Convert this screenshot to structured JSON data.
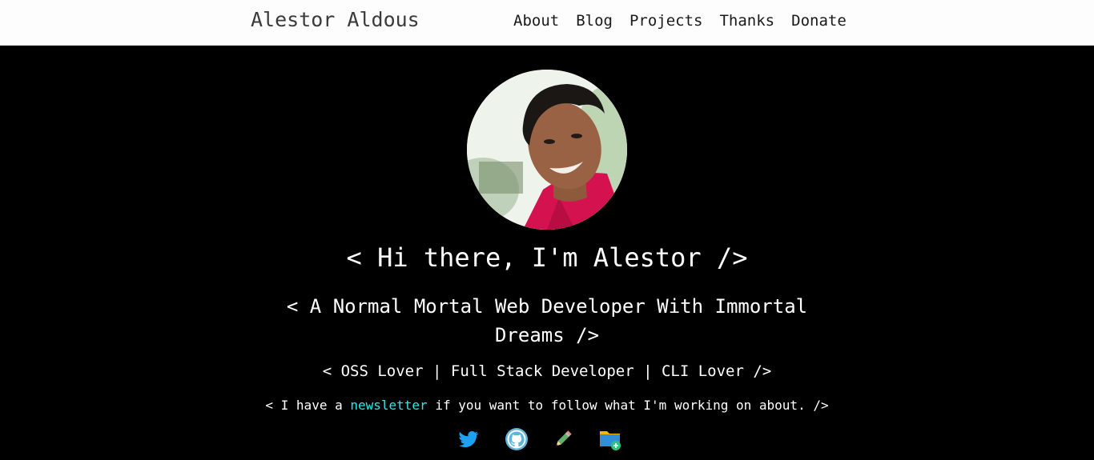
{
  "header": {
    "brand": "Alestor Aldous",
    "nav": [
      "About",
      "Blog",
      "Projects",
      "Thanks",
      "Donate"
    ]
  },
  "hero": {
    "avatar_alt": "profile photo",
    "heading": "< Hi there, I'm Alestor />",
    "tagline": "< A Normal Mortal Web Developer With Immortal Dreams />",
    "roles": "< OSS Lover | Full Stack Developer | CLI Lover />",
    "newsletter": {
      "before": "< I have a ",
      "link": "newsletter",
      "after": " if you want to follow what I'm working on about. />"
    }
  },
  "socials": [
    {
      "icon": "twitter-icon"
    },
    {
      "icon": "github-icon"
    },
    {
      "icon": "pencil-icon"
    },
    {
      "icon": "folder-icon"
    }
  ],
  "colors": {
    "header_bg": "#fdfdfd",
    "page_bg": "#000000",
    "link_accent": "#2ee8e8",
    "twitter_blue": "#1da1f2"
  }
}
